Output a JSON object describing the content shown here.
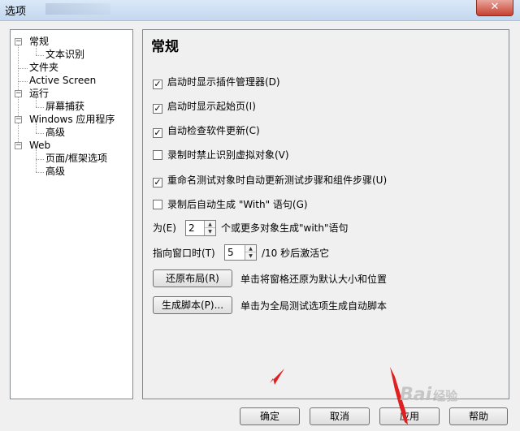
{
  "window": {
    "title": "选项",
    "close_glyph": "✕"
  },
  "tree": [
    {
      "label": "常规",
      "expander": "−"
    },
    {
      "label": "文本识别"
    },
    {
      "label": "文件夹"
    },
    {
      "label": "Active Screen"
    },
    {
      "label": "运行",
      "expander": "−"
    },
    {
      "label": "屏幕捕获"
    },
    {
      "label": "Windows 应用程序",
      "expander": "−"
    },
    {
      "label": "高级"
    },
    {
      "label": "Web",
      "expander": "−"
    },
    {
      "label": "页面/框架选项"
    },
    {
      "label": "高级"
    }
  ],
  "panel": {
    "title": "常规",
    "checkboxes": [
      {
        "label": "启动时显示插件管理器(D)",
        "checked": true
      },
      {
        "label": "启动时显示起始页(I)",
        "checked": true
      },
      {
        "label": "自动检查软件更新(C)",
        "checked": true
      },
      {
        "label": "录制时禁止识别虚拟对象(V)",
        "checked": false
      },
      {
        "label": "重命名测试对象时自动更新测试步骤和组件步骤(U)",
        "checked": true
      },
      {
        "label": "录制后自动生成 \"With\" 语句(G)",
        "checked": false
      }
    ],
    "check_mark": "✓",
    "with_row": {
      "prefix": "为(E)",
      "value": "2",
      "suffix": "个或更多对象生成\"with\"语句"
    },
    "pointer_row": {
      "prefix": "指向窗口时(T)",
      "value": "5",
      "suffix": "/10 秒后激活它"
    },
    "spin_up": "▲",
    "spin_down": "▼",
    "restore": {
      "button": "还原布局(R)",
      "desc": "单击将窗格还原为默认大小和位置"
    },
    "generate": {
      "button": "生成脚本(P)...",
      "desc": "单击为全局测试选项生成自动脚本"
    }
  },
  "buttons": {
    "ok": "确定",
    "cancel": "取消",
    "apply": "应用",
    "help": "帮助"
  },
  "colors": {
    "annotation_arrow": "#e02020"
  },
  "watermark": {
    "brand": "Bai",
    "suffix": "经验"
  }
}
